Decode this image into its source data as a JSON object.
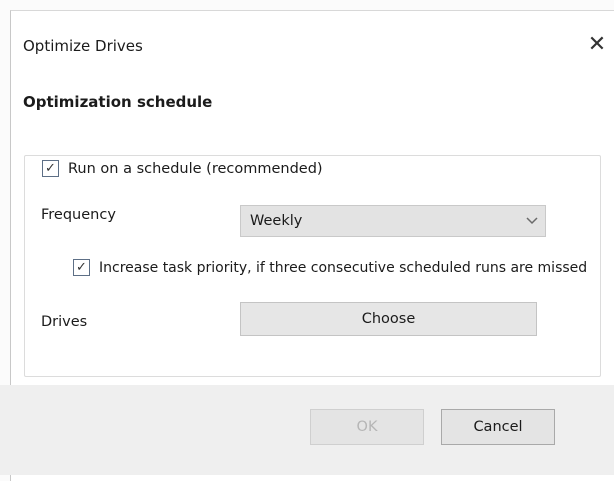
{
  "window": {
    "title": "Optimize Drives",
    "close_glyph": "✕"
  },
  "section_heading": "Optimization schedule",
  "schedule": {
    "run_on_schedule": {
      "label": "Run on a schedule (recommended)",
      "checked": true
    },
    "frequency": {
      "label": "Frequency",
      "value": "Weekly",
      "chevron_icon": "chevron-down-icon"
    },
    "increase_priority": {
      "label": "Increase task priority, if three consecutive scheduled runs are missed",
      "checked": true
    },
    "drives": {
      "label": "Drives",
      "button_label": "Choose"
    }
  },
  "footer": {
    "ok_label": "OK",
    "ok_enabled": false,
    "cancel_label": "Cancel"
  },
  "colors": {
    "footer_background": "#efefef",
    "disabled_text": "#b5b5b5"
  }
}
